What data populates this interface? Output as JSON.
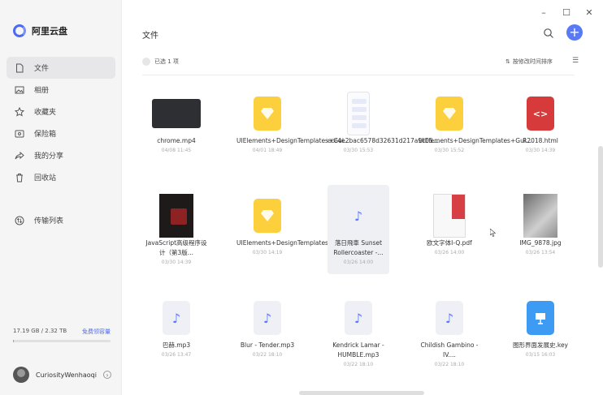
{
  "app": {
    "name": "阿里云盘"
  },
  "window": {
    "minimize": "–",
    "maximize": "☐",
    "close": "✕"
  },
  "sidebar": {
    "items": [
      {
        "label": "文件",
        "icon": "file-icon",
        "active": true
      },
      {
        "label": "相册",
        "icon": "photo-icon"
      },
      {
        "label": "收藏夹",
        "icon": "star-icon"
      },
      {
        "label": "保险箱",
        "icon": "safe-icon"
      },
      {
        "label": "我的分享",
        "icon": "share-icon"
      },
      {
        "label": "回收站",
        "icon": "trash-icon"
      },
      {
        "label": "传输列表",
        "icon": "transfer-icon"
      }
    ],
    "storage": {
      "used": "17.19 GB / 2.32 TB",
      "upgrade": "免费领容量",
      "fraction": 0.007
    },
    "user": {
      "name": "CuriosityWenhaoqi"
    }
  },
  "main": {
    "title": "文件",
    "selected": "已选 1 项",
    "sort": "按修改时间排序",
    "files": [
      {
        "name": "chrome.mp4",
        "date": "04/08 11:45",
        "type": "video"
      },
      {
        "name": "UIElements+DesignTemplates+Gui...",
        "date": "04/01 18:49",
        "type": "sketch"
      },
      {
        "name": "ccc4e2bac6578d32631d217a9c05...",
        "date": "03/30 15:53",
        "type": "phone"
      },
      {
        "name": "UIElements+DesignTemplates+Gui...",
        "date": "03/30 15:52",
        "type": "sketch"
      },
      {
        "name": "R2018.html",
        "date": "03/30 14:39",
        "type": "html"
      },
      {
        "name": "JavaScript高级程序设计（第3版...",
        "date": "03/30 14:39",
        "type": "book"
      },
      {
        "name": "UIElements+DesignTemplates+Gui...",
        "date": "03/30 14:19",
        "type": "sketch"
      },
      {
        "name": "落日飛車 Sunset Rollercoaster -...",
        "date": "03/26 14:00",
        "type": "audio",
        "selected": true
      },
      {
        "name": "欧文字体Ⅰ-Q.pdf",
        "date": "03/26 14:00",
        "type": "pdf"
      },
      {
        "name": "IMG_9878.jpg",
        "date": "03/26 13:54",
        "type": "photo"
      },
      {
        "name": "巴赫.mp3",
        "date": "03/26 13:47",
        "type": "audio"
      },
      {
        "name": "Blur - Tender.mp3",
        "date": "03/22 18:10",
        "type": "audio"
      },
      {
        "name": "Kendrick Lamar - HUMBLE.mp3",
        "date": "03/22 18:10",
        "type": "audio"
      },
      {
        "name": "Childish Gambino - IV....",
        "date": "03/22 18:10",
        "type": "audio"
      },
      {
        "name": "图形界面发展史.key",
        "date": "03/15 16:03",
        "type": "key"
      }
    ]
  }
}
